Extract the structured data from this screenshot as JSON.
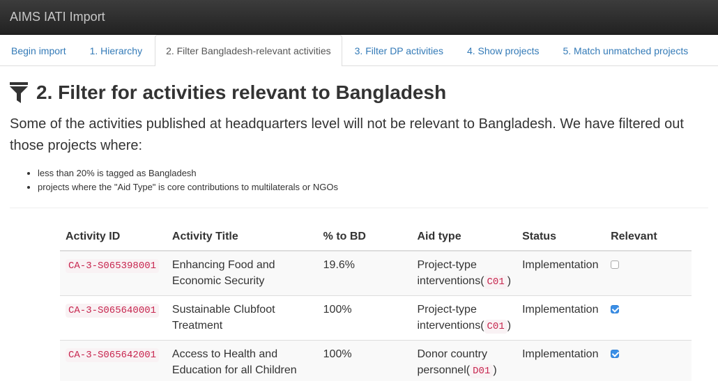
{
  "app": {
    "title": "AIMS IATI Import"
  },
  "tabs": [
    {
      "label": "Begin import",
      "active": false
    },
    {
      "label": "1. Hierarchy",
      "active": false
    },
    {
      "label": "2. Filter Bangladesh-relevant activities",
      "active": true
    },
    {
      "label": "3. Filter DP activities",
      "active": false
    },
    {
      "label": "4. Show projects",
      "active": false
    },
    {
      "label": "5. Match unmatched projects",
      "active": false
    }
  ],
  "page": {
    "icon": "filter-icon",
    "title": "2. Filter for activities relevant to Bangladesh",
    "lead": "Some of the activities published at headquarters level will not be relevant to Bangladesh. We have filtered out those projects where:",
    "criteria": [
      "less than 20% is tagged as Bangladesh",
      "projects where the \"Aid Type\" is core contributions to multilaterals or NGOs"
    ]
  },
  "table": {
    "headers": {
      "id": "Activity ID",
      "title": "Activity Title",
      "pct": "% to BD",
      "aid": "Aid type",
      "status": "Status",
      "relevant": "Relevant"
    },
    "rows": [
      {
        "id": "CA-3-S065398001",
        "title": "Enhancing Food and Economic Security",
        "pct": "19.6%",
        "aid_name": "Project-type interventions",
        "aid_code": "C01",
        "status": "Implementation",
        "relevant": false
      },
      {
        "id": "CA-3-S065640001",
        "title": "Sustainable Clubfoot Treatment",
        "pct": "100%",
        "aid_name": "Project-type interventions",
        "aid_code": "C01",
        "status": "Implementation",
        "relevant": true
      },
      {
        "id": "CA-3-S065642001",
        "title": "Access to Health and Education for all Children",
        "pct": "100%",
        "aid_name": "Donor country personnel",
        "aid_code": "D01",
        "status": "Implementation",
        "relevant": true
      }
    ]
  },
  "colors": {
    "link": "#337ab7",
    "code_text": "#c7254e",
    "code_bg": "#f9f2f4",
    "checkbox_on": "#3b8fe6",
    "navbar": "#222222"
  }
}
